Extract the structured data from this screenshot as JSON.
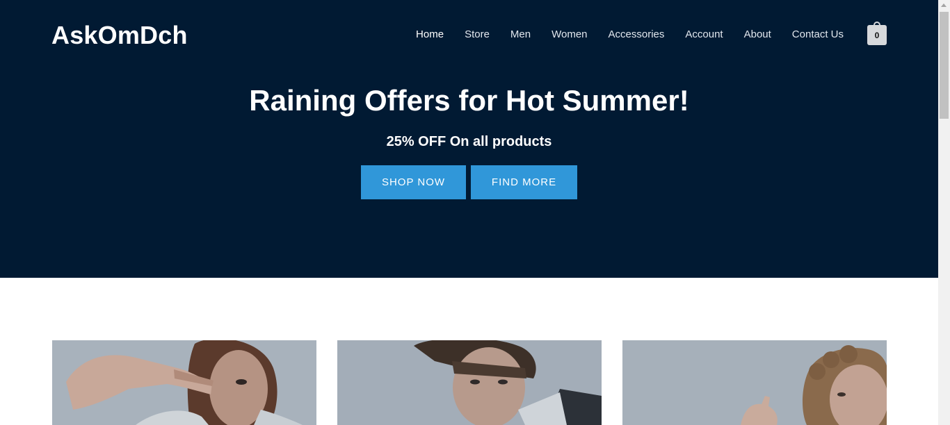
{
  "site": {
    "logo": "AskOmDch"
  },
  "nav": {
    "items": [
      {
        "label": "Home",
        "active": true
      },
      {
        "label": "Store"
      },
      {
        "label": "Men"
      },
      {
        "label": "Women"
      },
      {
        "label": "Accessories"
      },
      {
        "label": "Account"
      },
      {
        "label": "About"
      },
      {
        "label": "Contact Us"
      }
    ],
    "cart_count": "0"
  },
  "hero": {
    "title": "Raining Offers for Hot Summer!",
    "subtitle": "25% OFF On all products",
    "shop_button": "SHOP NOW",
    "find_button": "FIND MORE"
  },
  "tiles": [
    {
      "name": "woman-peace-sign-photo"
    },
    {
      "name": "man-portrait-photo"
    },
    {
      "name": "woman-curly-hair-photo"
    }
  ],
  "colors": {
    "hero_bg": "#011a33",
    "button_bg": "#3097d9",
    "text_light": "#ffffff"
  }
}
